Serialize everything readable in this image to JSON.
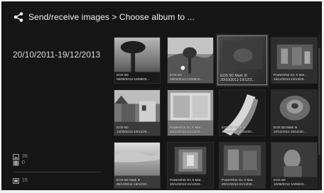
{
  "header": {
    "breadcrumb": "Send/receive images > Choose album to ..."
  },
  "sidebar": {
    "date_range": "20/10/2011-19/12/2013",
    "image_count": "26",
    "movie_count": "0",
    "total_count": "15"
  },
  "albums": [
    {
      "model": "EOS 6D",
      "dates": "06/08/2012-15/08/20..."
    },
    {
      "model": "EOS 6D",
      "dates": "08/08/2012-15/08/20..."
    },
    {
      "model": "EOS 5D Mark III",
      "dates": "20/10/2011-19/12/2...",
      "selected": true
    },
    {
      "model": "PowerShot G1 X Mar...",
      "dates": "16/12/2013-16/12/20..."
    },
    {
      "model": "EOS 6D",
      "dates": "14/09/2012-19/12/20..."
    },
    {
      "model": "PowerShot G1 X Mar...",
      "dates": "16/12/2013-21/12/20..."
    },
    {
      "model": "EOS 5D Mark III",
      "dates": "16/11/2011-19/12/20..."
    },
    {
      "model": "EOS 5D Mark III",
      "dates": "16/11/2011-19/12/20..."
    },
    {
      "model": "EOS 5D Mark III",
      "dates": "05/10/2011-19/12/20..."
    },
    {
      "model": "PowerShot G1 X Mar...",
      "dates": "20/12/2013-21/12/20..."
    },
    {
      "model": "PowerShot G1 X Mar...",
      "dates": "20/12/2013-21/12/20..."
    },
    {
      "model": "EOS 6D",
      "dates": "10/08/2012-10/08/20..."
    }
  ]
}
